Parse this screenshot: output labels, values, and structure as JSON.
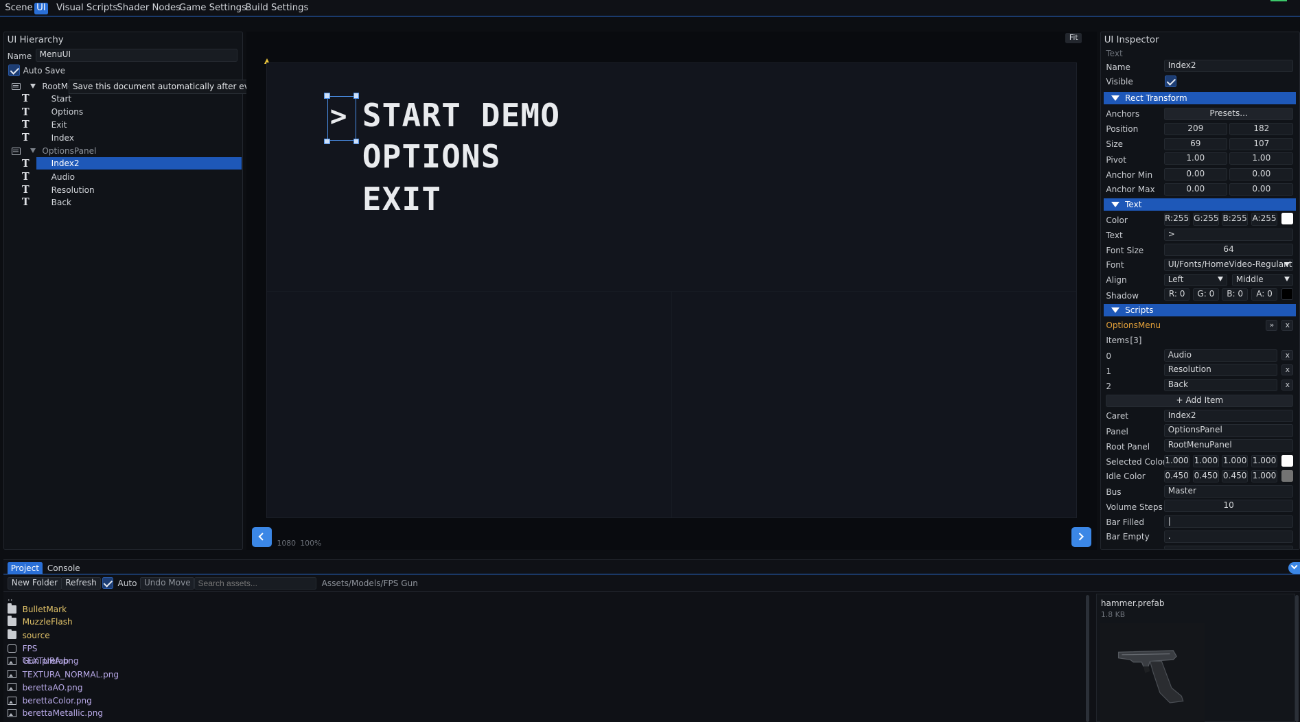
{
  "menu": {
    "tabs": [
      {
        "label": "Scene",
        "active": false
      },
      {
        "label": "UI",
        "active": true
      },
      {
        "label": "Visual Scripts",
        "active": false
      },
      {
        "label": "Shader Nodes",
        "active": false
      },
      {
        "label": "Game Settings",
        "active": false
      },
      {
        "label": "Build Settings",
        "active": false
      }
    ]
  },
  "hierarchy": {
    "title": "UI Hierarchy",
    "name_label": "Name",
    "name_value": "MenuUI",
    "autosave_label": "Auto Save",
    "autosave_checked": true,
    "tooltip": "Save this document automatically after every change.",
    "items": [
      {
        "label": "RootMe",
        "type": "panel",
        "expanded": true,
        "selected": false
      },
      {
        "label": "Start",
        "type": "text",
        "selected": false
      },
      {
        "label": "Options",
        "type": "text",
        "selected": false
      },
      {
        "label": "Exit",
        "type": "text",
        "selected": false
      },
      {
        "label": "Index",
        "type": "text",
        "selected": false
      },
      {
        "label": "OptionsPanel",
        "type": "panel",
        "expanded": true,
        "selected": false
      },
      {
        "label": "Index2",
        "type": "text",
        "selected": true
      },
      {
        "label": "Audio",
        "type": "text",
        "selected": false
      },
      {
        "label": "Resolution",
        "type": "text",
        "selected": false
      },
      {
        "label": "Back",
        "type": "text",
        "selected": false
      }
    ]
  },
  "canvas": {
    "fit_label": "Fit",
    "caret": ">",
    "menu_items": [
      "START DEMO",
      "OPTIONS",
      "EXIT"
    ],
    "resolution_text": "1080",
    "zoom_text": "100%"
  },
  "inspector": {
    "title": "UI Inspector",
    "type_label": "Text",
    "name_label": "Name",
    "name_value": "Index2",
    "visible_label": "Visible",
    "visible_checked": true,
    "rect": {
      "header": "Rect Transform",
      "anchors_label": "Anchors",
      "presets_label": "Presets...",
      "position_label": "Position",
      "position": [
        "209",
        "182"
      ],
      "size_label": "Size",
      "size": [
        "69",
        "107"
      ],
      "pivot_label": "Pivot",
      "pivot": [
        "1.00",
        "1.00"
      ],
      "anchor_min_label": "Anchor Min",
      "anchor_min": [
        "0.00",
        "0.00"
      ],
      "anchor_max_label": "Anchor Max",
      "anchor_max": [
        "0.00",
        "0.00"
      ]
    },
    "text": {
      "header": "Text",
      "color_label": "Color",
      "color_values": [
        "R:255",
        "G:255",
        "B:255",
        "A:255"
      ],
      "color_swatch": "#ffffff",
      "text_label": "Text",
      "text_value": ">",
      "font_size_label": "Font Size",
      "font_size_value": "64",
      "font_label": "Font",
      "font_value": "UI/Fonts/HomeVideo-Regular.t",
      "align_label": "Align",
      "align_h": "Left",
      "align_v": "Middle",
      "shadow_label": "Shadow",
      "shadow_values": [
        "R: 0",
        "G: 0",
        "B: 0",
        "A: 0"
      ],
      "shadow_swatch": "#000000"
    },
    "scripts": {
      "header": "Scripts",
      "script_name": "OptionsMenu",
      "script_btn_1": "»",
      "script_btn_2": "x",
      "items_label": "Items",
      "items_count": "[3]",
      "items": [
        {
          "index": "0",
          "value": "Audio"
        },
        {
          "index": "1",
          "value": "Resolution"
        },
        {
          "index": "2",
          "value": "Back"
        }
      ],
      "remove_label": "x",
      "add_item_label": "+ Add Item",
      "caret_label": "Caret",
      "caret_value": "Index2",
      "panel_label": "Panel",
      "panel_value": "OptionsPanel",
      "root_panel_label": "Root Panel",
      "root_panel_value": "RootMenuPanel",
      "selected_color_label": "Selected Color",
      "selected_color": [
        "1.000",
        "1.000",
        "1.000",
        "1.000"
      ],
      "selected_swatch": "#ffffff",
      "idle_color_label": "Idle Color",
      "idle_color": [
        "0.450",
        "0.450",
        "0.450",
        "1.000"
      ],
      "idle_swatch": "#737373",
      "bus_label": "Bus",
      "bus_value": "Master",
      "volume_steps_label": "Volume Steps",
      "volume_steps_value": "10",
      "bar_filled_label": "Bar Filled",
      "bar_filled_value": "|",
      "bar_empty_label": "Bar Empty",
      "bar_empty_value": "."
    }
  },
  "project": {
    "tabs": [
      {
        "label": "Project",
        "active": true
      },
      {
        "label": "Console",
        "active": false
      }
    ],
    "new_folder_label": "New Folder",
    "refresh_label": "Refresh",
    "auto_label": "Auto",
    "auto_checked": true,
    "undo_move_label": "Undo Move",
    "search_placeholder": "Search assets...",
    "path": "Assets/Models/FPS Gun",
    "parent_label": "..",
    "files": [
      {
        "label": "BulletMark",
        "kind": "folder"
      },
      {
        "label": "MuzzleFlash",
        "kind": "folder"
      },
      {
        "label": "source",
        "kind": "folder"
      },
      {
        "label": "FPS Gun.prefab",
        "kind": "prefab"
      },
      {
        "label": "TEXTURA.png",
        "kind": "image"
      },
      {
        "label": "TEXTURA_NORMAL.png",
        "kind": "image"
      },
      {
        "label": "berettaAO.png",
        "kind": "image"
      },
      {
        "label": "berettaColor.png",
        "kind": "image"
      },
      {
        "label": "berettaMetallic.png",
        "kind": "image"
      }
    ],
    "preview_name": "hammer.prefab",
    "preview_size": "1.8 KB"
  },
  "colors": {
    "accent": "#2a6fd6",
    "selection": "#1e58b8",
    "folder_text": "#e3c469",
    "file_text": "#b7a8e6",
    "script_name": "#e7a33a"
  }
}
